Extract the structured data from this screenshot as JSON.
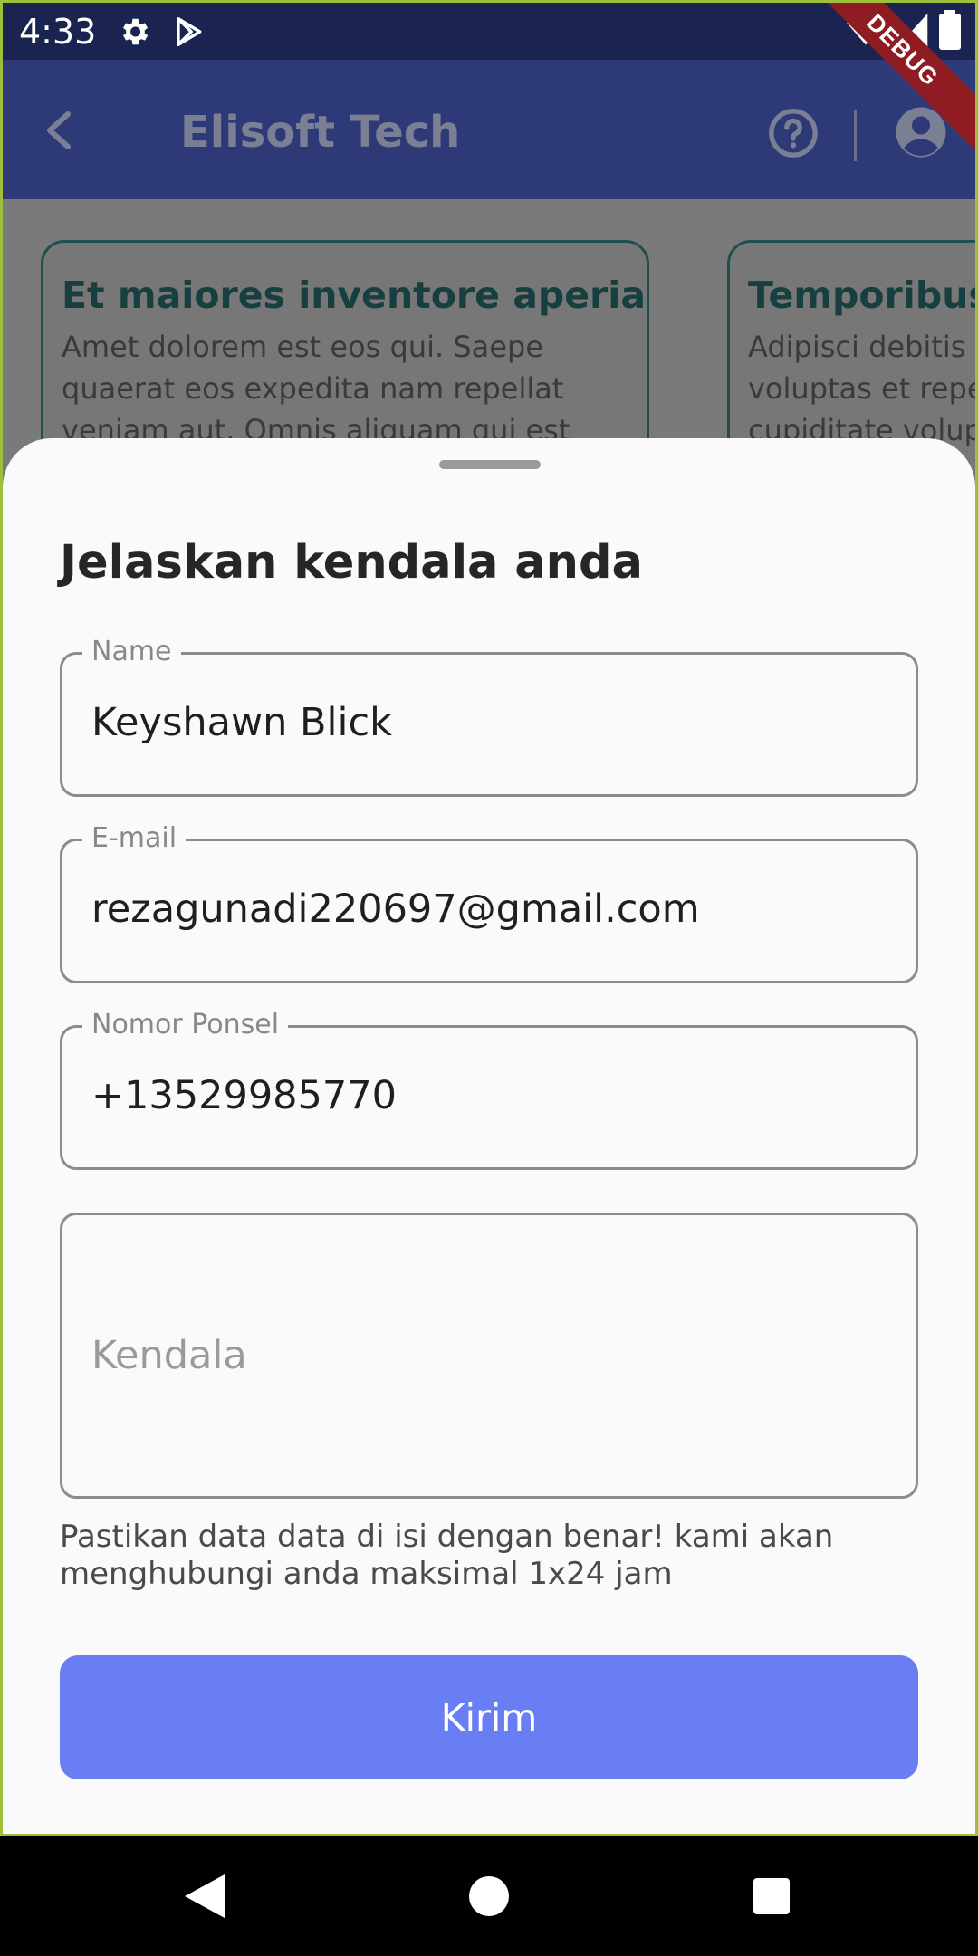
{
  "status_bar": {
    "time": "4:33",
    "icons": [
      "gear-icon",
      "play-store-icon",
      "wifi-icon",
      "signal-icon",
      "battery-icon"
    ]
  },
  "debug_banner": "DEBUG",
  "app_bar": {
    "title": "Elisoft Tech",
    "icons": [
      "back-arrow-icon",
      "help-circle-icon",
      "account-circle-icon"
    ]
  },
  "cards": [
    {
      "title": "Et maiores inventore aperiam.",
      "body": "Amet dolorem est eos qui. Saepe quaerat eos expedita nam repellat veniam aut. Omnis aliquam qui est nisi"
    },
    {
      "title": "Temporibus a",
      "body": "Adipisci debitis u voluptas et repell cupiditate volupta"
    }
  ],
  "sheet": {
    "title": "Jelaskan kendala anda",
    "fields": {
      "name": {
        "label": "Name",
        "value": "Keyshawn Blick"
      },
      "email": {
        "label": "E-mail",
        "value": "rezagunadi220697@gmail.com"
      },
      "phone": {
        "label": "Nomor Ponsel",
        "value": "+13529985770"
      },
      "issue": {
        "placeholder": "Kendala"
      }
    },
    "helper_text": "Pastikan data data di isi dengan benar! kami akan menghubungi anda maksimal 1x24 jam",
    "submit_label": "Kirim"
  },
  "nav_bar": {
    "icons": [
      "back-triangle-icon",
      "home-circle-icon",
      "recents-square-icon"
    ]
  },
  "colors": {
    "status_bar": "#1b2450",
    "app_bar": "#2e3a78",
    "scrim": "#7a7a7a",
    "sheet": "#fafafa",
    "button": "#6a7ef3",
    "card_border": "#1f4f4f"
  }
}
